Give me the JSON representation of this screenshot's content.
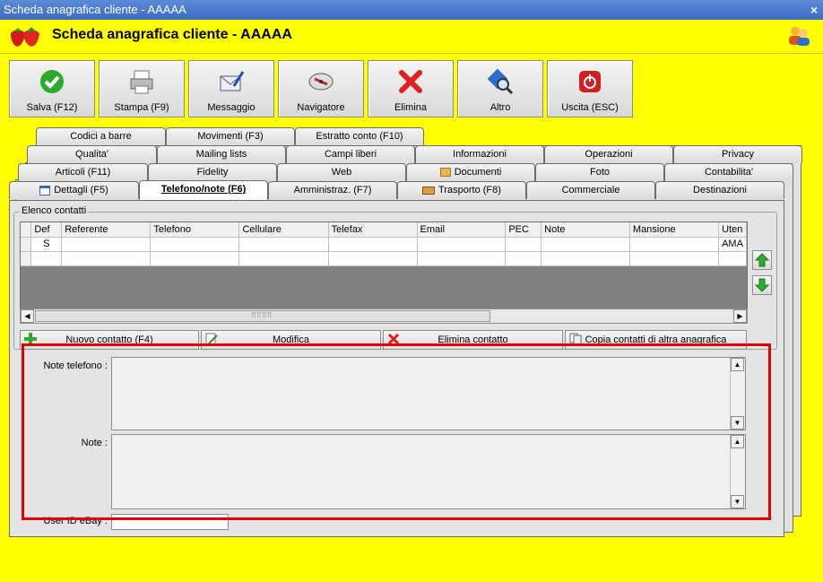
{
  "window": {
    "title": "Scheda anagrafica cliente - AAAAA",
    "close_glyph": "×"
  },
  "header": {
    "title": "Scheda anagrafica cliente - AAAAA",
    "logo_icon": "strawberry-icon",
    "users_icon": "users-icon"
  },
  "toolbar": [
    {
      "label": "Salva (F12)",
      "icon": "checkmark-icon"
    },
    {
      "label": "Stampa (F9)",
      "icon": "printer-icon"
    },
    {
      "label": "Messaggio",
      "icon": "envelope-icon"
    },
    {
      "label": "Navigatore",
      "icon": "compass-icon"
    },
    {
      "label": "Elimina",
      "icon": "red-x-icon"
    },
    {
      "label": "Altro",
      "icon": "magnifier-icon"
    },
    {
      "label": "Uscita (ESC)",
      "icon": "power-icon"
    }
  ],
  "tabs": {
    "row1": [
      "Codici a barre",
      "Movimenti (F3)",
      "Estratto conto (F10)"
    ],
    "row2": [
      "Qualita'",
      "Mailing lists",
      "Campi liberi",
      "Informazioni",
      "Operazioni",
      "Privacy"
    ],
    "row3": [
      "Articoli (F11)",
      "Fidelity",
      "Web",
      "Documenti",
      "Foto",
      "Contabilita'"
    ],
    "row4": [
      "Dettagli (F5)",
      "Telefono/note (F6)",
      "Amministraz. (F7)",
      "Trasporto (F8)",
      "Commerciale",
      "Destinazioni"
    ],
    "active": "Telefono/note (F6)"
  },
  "contacts": {
    "group_label": "Elenco contatti",
    "columns": [
      "Def",
      "Referente",
      "Telefono",
      "Cellulare",
      "Telefax",
      "Email",
      "PEC",
      "Note",
      "Mansione",
      "Uten"
    ],
    "rows": [
      [
        "S",
        "",
        "",
        "",
        "",
        "",
        "",
        "",
        "",
        "AMA"
      ],
      [
        "",
        "",
        "",
        "",
        "",
        "",
        "",
        "",
        "",
        ""
      ]
    ],
    "scroll_grip": "⠿⠿⠿⠿"
  },
  "actions": [
    {
      "label": "Nuovo contatto (F4)",
      "icon": "green-plus-icon"
    },
    {
      "label": "Modifica",
      "icon": "pencil-icon"
    },
    {
      "label": "Elimina contatto",
      "icon": "red-x-icon"
    },
    {
      "label": "Copia contatti di altra anagrafica",
      "icon": "copy-icon"
    }
  ],
  "fields": {
    "note_telefono_label": "Note telefono :",
    "note_telefono_value": "",
    "note_label": "Note :",
    "note_value": "",
    "user_id_ebay_label": "User ID eBay :",
    "user_id_ebay_value": ""
  },
  "colors": {
    "background": "#FFFF00",
    "highlight_box": "#E00000",
    "titlebar": "#3C6BC2"
  }
}
